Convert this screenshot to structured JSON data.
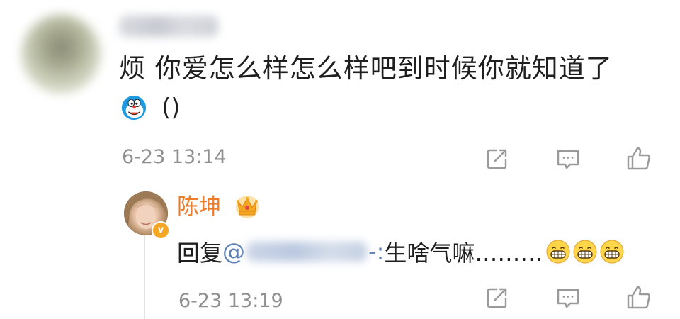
{
  "comment": {
    "text": "烦 你爱怎么样怎么样吧到时候你就知道了",
    "parens": "()",
    "timestamp": "6-23 13:14",
    "emoji": "doraemon-emoji"
  },
  "reply": {
    "author": "陈坤",
    "prefix": "回复",
    "at": "@",
    "mention_tail": "-:",
    "text": "生啥气嘛………",
    "timestamp": "6-23 13:19",
    "badge": "v",
    "emoji": "grin-emoji"
  },
  "actions": {
    "icons": [
      "share-icon",
      "comment-icon",
      "like-icon"
    ]
  },
  "colors": {
    "name_orange": "#ee7d2b",
    "mention_blue": "#5b7fb5",
    "meta_gray": "#8f8f8f",
    "icon_gray": "#9a9a9a",
    "badge_gold": "#f5a623"
  }
}
